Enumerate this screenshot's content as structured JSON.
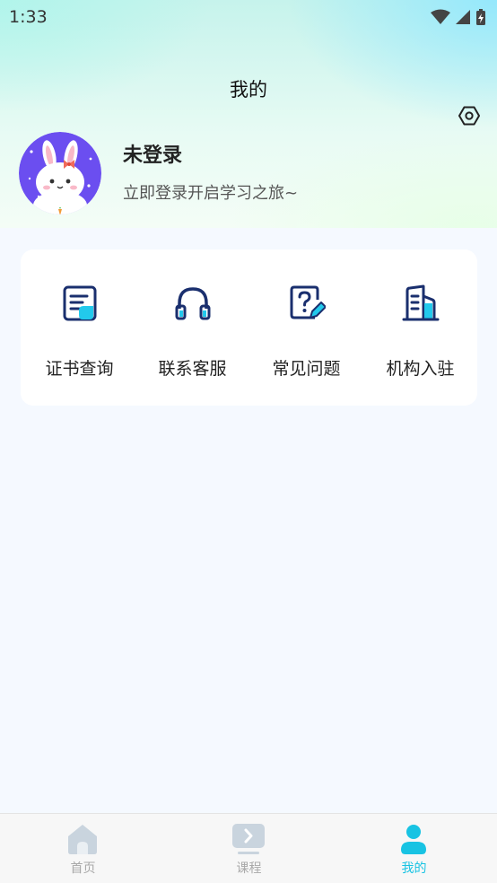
{
  "status_bar": {
    "time": "1:33"
  },
  "header": {
    "title": "我的"
  },
  "profile": {
    "name": "未登录",
    "subtitle": "立即登录开启学习之旅~"
  },
  "menu": {
    "items": [
      {
        "label": "证书查询",
        "icon": "certificate-icon"
      },
      {
        "label": "联系客服",
        "icon": "headset-icon"
      },
      {
        "label": "常见问题",
        "icon": "faq-icon"
      },
      {
        "label": "机构入驻",
        "icon": "building-icon"
      }
    ]
  },
  "tabbar": {
    "items": [
      {
        "label": "首页",
        "icon": "home-icon",
        "active": false
      },
      {
        "label": "课程",
        "icon": "course-icon",
        "active": false
      },
      {
        "label": "我的",
        "icon": "profile-icon",
        "active": true
      }
    ]
  },
  "colors": {
    "accent": "#18c3e3",
    "icon_navy": "#1a2f6e",
    "avatar_bg": "#6b4ef0"
  }
}
